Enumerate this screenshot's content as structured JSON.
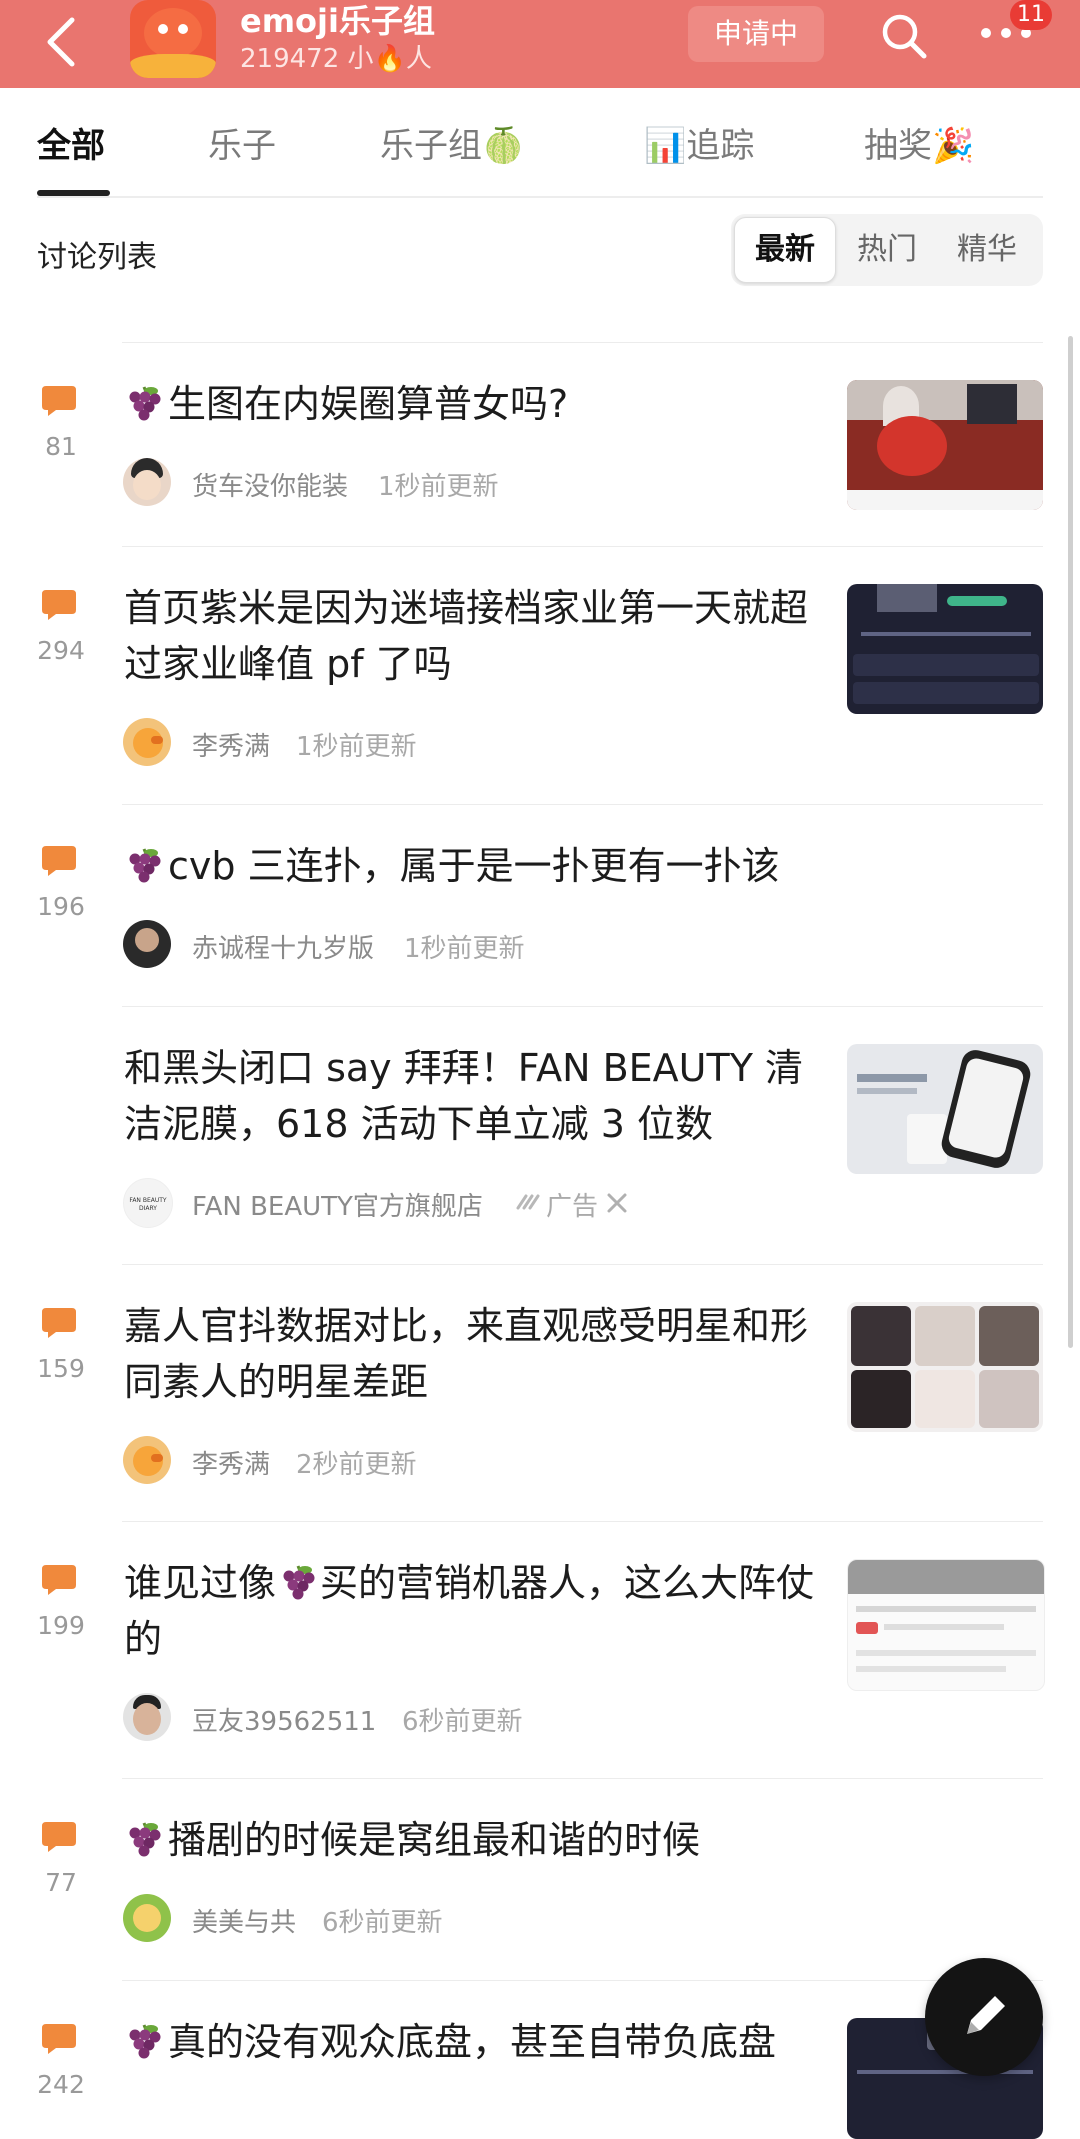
{
  "colors": {
    "header": "#e9756f",
    "accent": "#f0893c",
    "text": "#1c1c1c",
    "muted": "#a8a8a8"
  },
  "header": {
    "group_name": "emoji乐子组",
    "members": "219472 小🔥人",
    "apply_label": "申请中",
    "badge_count": "11",
    "icons": [
      "back-arrow-icon",
      "search-icon",
      "more-icon"
    ]
  },
  "tabs": [
    {
      "label": "全部",
      "active": true
    },
    {
      "label": "乐子"
    },
    {
      "label": "乐子组🍈"
    },
    {
      "label": "📊追踪"
    },
    {
      "label": "抽奖🎉"
    }
  ],
  "list": {
    "title": "讨论列表",
    "sort_options": [
      {
        "label": "最新",
        "active": true
      },
      {
        "label": "热门"
      },
      {
        "label": "精华"
      }
    ]
  },
  "posts": [
    {
      "comments": "81",
      "title": "生图在内娱圈算普女吗?",
      "grape": true,
      "author": "货车没你能装",
      "time": "1秒前更新"
    },
    {
      "comments": "294",
      "title": "首页紫米是因为迷墙接档家业第一天就超过家业峰值 pf 了吗",
      "grape": false,
      "author": "李秀满",
      "time": "1秒前更新"
    },
    {
      "comments": "196",
      "title": "cvb 三连扑，属于是一扑更有一扑该",
      "grape": true,
      "author": "赤诚程十九岁版",
      "time": "1秒前更新"
    },
    {
      "ad": true,
      "title": "和黑头闭口 say 拜拜！FAN BEAUTY 清洁泥膜，618 活动下单立减 3 位数",
      "author": "FAN BEAUTY官方旗舰店",
      "ad_label": "广告",
      "logo_text": "FAN BEAUTY DIARY"
    },
    {
      "comments": "159",
      "title": "嘉人官抖数据对比，来直观感受明星和形同素人的明星差距",
      "grape": false,
      "author": "李秀满",
      "time": "2秒前更新"
    },
    {
      "comments": "199",
      "title_before": "谁见过像",
      "title_after": "买的营销机器人，这么大阵仗的",
      "author": "豆友39562511",
      "time": "6秒前更新"
    },
    {
      "comments": "77",
      "title": "播剧的时候是窝组最和谐的时候",
      "grape": true,
      "author": "美美与共",
      "time": "6秒前更新"
    },
    {
      "comments": "242",
      "title": "真的没有观众底盘，甚至自带负底盘",
      "grape": true
    }
  ]
}
